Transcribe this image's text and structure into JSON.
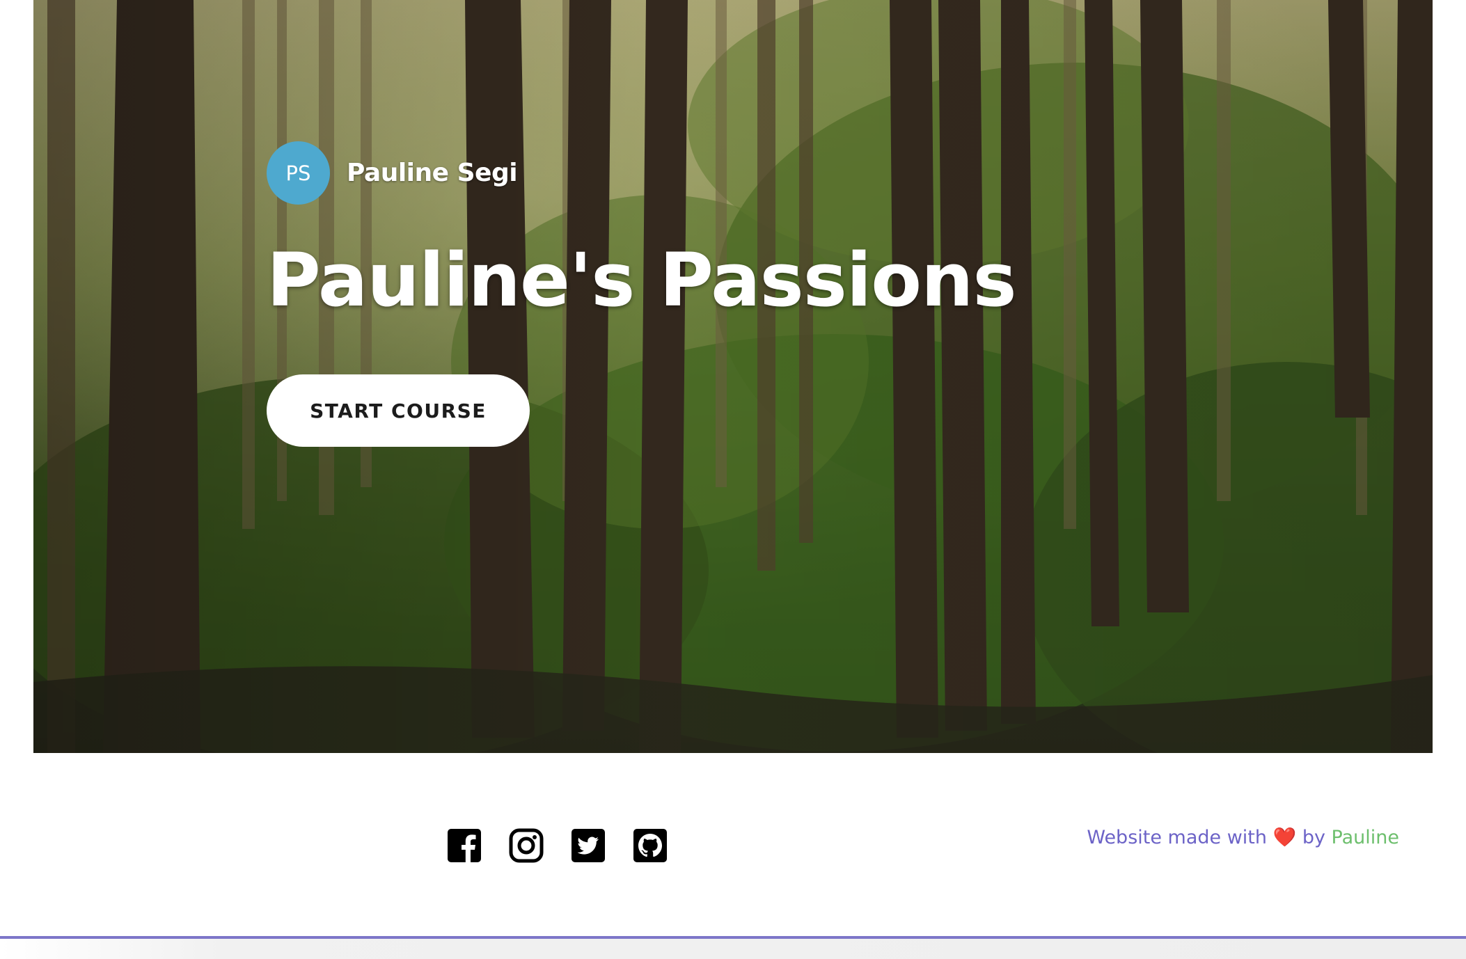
{
  "hero": {
    "author_initials": "PS",
    "author_name": "Pauline Segi",
    "title": "Pauline's Passions",
    "cta_label": "START COURSE",
    "background": "forest-photo",
    "avatar_color": "#4ea9cf"
  },
  "footer": {
    "social": [
      {
        "icon": "facebook-icon"
      },
      {
        "icon": "instagram-icon"
      },
      {
        "icon": "twitter-icon"
      },
      {
        "icon": "github-icon"
      }
    ],
    "credit_prefix": "Website made with",
    "credit_heart": "❤️",
    "credit_by": "by",
    "credit_author": "Pauline",
    "credit_color": "#6c63c7",
    "author_link_color": "#6dbf6d"
  },
  "accent_rule_color": "#7d76c9"
}
